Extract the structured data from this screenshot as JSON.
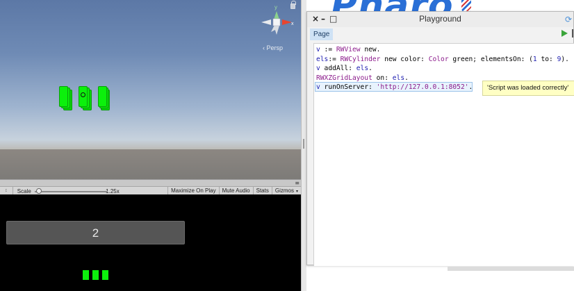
{
  "unity": {
    "scene": {
      "projection_label": "‹ Persp",
      "gizmo": {
        "y_label": "y",
        "x_label": "x"
      }
    },
    "game_toolbar": {
      "menu_dots": "≡",
      "display_arrow": "↕",
      "scale_label": "Scale",
      "scale_value": "1.25x",
      "scale_fraction": 0.0,
      "buttons": [
        "Maximize On Play",
        "Mute Audio",
        "Stats",
        "Gizmos"
      ],
      "gizmos_caret": "▾"
    },
    "game_view": {
      "counter_value": "2",
      "mini_cylinder_count": 3
    },
    "colors": {
      "cylinder_green": "#0cf00c",
      "game_bg": "#000000"
    }
  },
  "playground": {
    "title": "Playground",
    "controls": {
      "close": "×",
      "minimize": "–",
      "maximize": "□"
    },
    "tab_label": "Page",
    "sync_icon": "⟳",
    "code_lines": [
      [
        {
          "t": "v",
          "c": "kw-var"
        },
        {
          "t": " := "
        },
        {
          "t": "RWView",
          "c": "kw-cls"
        },
        {
          "t": " new."
        }
      ],
      [
        {
          "t": "els",
          "c": "kw-var"
        },
        {
          "t": ":= "
        },
        {
          "t": "RWCylinder",
          "c": "kw-cls"
        },
        {
          "t": " new color: "
        },
        {
          "t": "Color",
          "c": "kw-cls"
        },
        {
          "t": " green; elementsOn: ("
        },
        {
          "t": "1",
          "c": "kw-num"
        },
        {
          "t": " to: "
        },
        {
          "t": "9",
          "c": "kw-num"
        },
        {
          "t": ")."
        }
      ],
      [
        {
          "t": "v",
          "c": "kw-var"
        },
        {
          "t": " addAll: "
        },
        {
          "t": "els",
          "c": "kw-var"
        },
        {
          "t": "."
        }
      ],
      [
        {
          "t": "RWXZGridLayout",
          "c": "kw-cls"
        },
        {
          "t": " on: "
        },
        {
          "t": "els",
          "c": "kw-var"
        },
        {
          "t": "."
        }
      ],
      [
        {
          "t": "v",
          "c": "kw-var"
        },
        {
          "t": " runOnServer: "
        },
        {
          "t": "'http://127.0.0.1:8052'",
          "c": "kw-str"
        },
        {
          "t": "."
        }
      ]
    ],
    "result_tooltip": "'Script was loaded correctly'"
  },
  "background": {
    "logo_text": "Pharo"
  }
}
